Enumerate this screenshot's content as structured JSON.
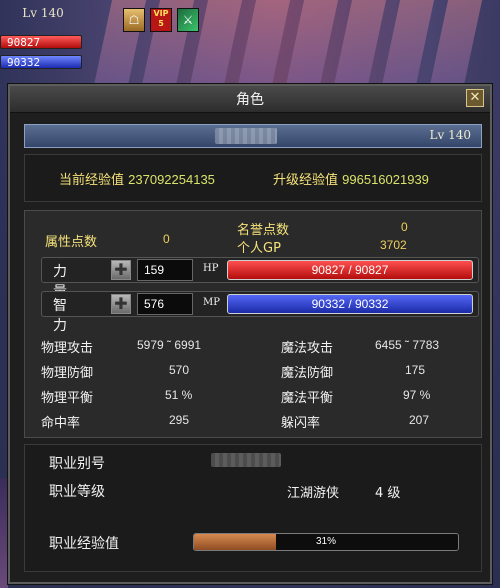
{
  "hud": {
    "level": "Lv 140",
    "hp": "90827",
    "mp": "90332"
  },
  "buffs": {
    "vip_top": "VIP",
    "vip_bottom": "5"
  },
  "window": {
    "title": "角色",
    "close_glyph": "✕",
    "level": "Lv 140",
    "exp_current_label": "当前经验值",
    "exp_current": "237092254135",
    "exp_next_label": "升级经验值",
    "exp_next": "996516021939"
  },
  "attributes": {
    "points_label": "属性点数",
    "points": "0",
    "honor_label": "名誉点数",
    "honor": "0",
    "gp_label": "个人GP",
    "gp": "3702"
  },
  "strength": {
    "label": "力量",
    "value": "159",
    "bar_tag": "HP",
    "bar_text": "90827 / 90827"
  },
  "intellect": {
    "label": "智力",
    "value": "576",
    "bar_tag": "MP",
    "bar_text": "90332 / 90332"
  },
  "combat_stats": [
    {
      "label": "物理攻击",
      "value": "5979 ˜ 6991"
    },
    {
      "label": "魔法攻击",
      "value": "6455 ˜ 7783"
    },
    {
      "label": "物理防御",
      "value": "570"
    },
    {
      "label": "魔法防御",
      "value": "175"
    },
    {
      "label": "物理平衡",
      "value": "51 %"
    },
    {
      "label": "魔法平衡",
      "value": "97 %"
    },
    {
      "label": "命中率",
      "value": "295"
    },
    {
      "label": "躲闪率",
      "value": "207"
    }
  ],
  "job": {
    "alias_label": "职业别号",
    "level_label": "职业等级",
    "level_name": "江湖游侠",
    "level_value": "4 级",
    "exp_label": "职业经验值",
    "exp_percent": 31,
    "exp_text": "31%"
  }
}
